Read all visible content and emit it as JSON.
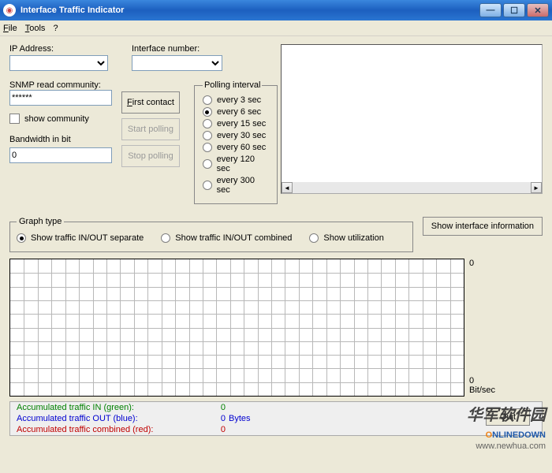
{
  "title": "Interface Traffic Indicator",
  "menu": {
    "file": "File",
    "tools": "Tools",
    "help": "?"
  },
  "labels": {
    "ip": "IP Address:",
    "iface": "Interface number:",
    "snmp": "SNMP read community:",
    "show_comm": "show community",
    "bandwidth": "Bandwidth in bit"
  },
  "values": {
    "ip": "",
    "iface": "",
    "snmp": "******",
    "show_comm_checked": false,
    "bandwidth": "0"
  },
  "buttons": {
    "first_contact": "First contact",
    "start_poll": "Start polling",
    "stop_poll": "Stop polling",
    "show_info": "Show interface information",
    "quit": "Quit"
  },
  "polling": {
    "legend": "Polling interval",
    "options": [
      "every 3 sec",
      "every 6 sec",
      "every 15 sec",
      "every 30 sec",
      "every 60 sec",
      "every 120 sec",
      "every 300 sec"
    ],
    "selected": 1
  },
  "graph_type": {
    "legend": "Graph type",
    "options": [
      "Show traffic IN/OUT separate",
      "Show traffic IN/OUT combined",
      "Show utilization"
    ],
    "selected": 0
  },
  "chart_data": {
    "type": "line",
    "series": [
      {
        "name": "IN",
        "values": []
      },
      {
        "name": "OUT",
        "values": []
      }
    ],
    "ymin": 0,
    "ymax": 0,
    "ylabel_top": "0",
    "ylabel_bottom": "0",
    "yunit": "Bit/sec"
  },
  "legend_rows": {
    "in": {
      "label": "Accumulated traffic IN (green):",
      "value": "0",
      "unit": ""
    },
    "out": {
      "label": "Accumulated traffic OUT (blue):",
      "value": "0",
      "unit": "Bytes"
    },
    "comb": {
      "label": "Accumulated traffic combined (red):",
      "value": "0",
      "unit": ""
    }
  },
  "watermark": {
    "cn": "华军软件园",
    "brand_o": "O",
    "brand_rest": "NLINEDOWN",
    "url": "www.newhua.com"
  }
}
